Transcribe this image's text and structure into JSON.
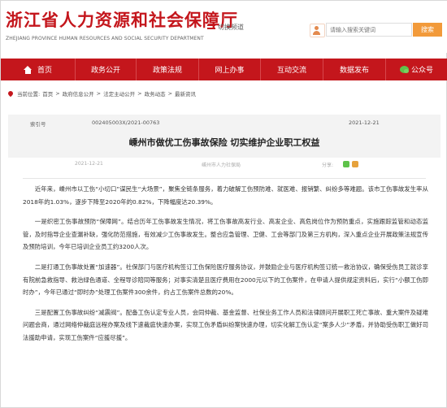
{
  "header": {
    "logo_cn": "浙江省人力资源和社会保障厅",
    "logo_en": "ZHEJIANG PROVINCE HUMAN RESOURCES AND SOCIAL SECURITY DEPARTMENT",
    "switch_label": "切换频道",
    "search_placeholder": "请输入搜索关键词",
    "search_button": "搜索"
  },
  "nav": {
    "items": [
      "首页",
      "政务公开",
      "政策法规",
      "网上办事",
      "互动交流",
      "数据发布"
    ],
    "wechat": "公众号"
  },
  "breadcrumb": {
    "prefix": "当前位置:",
    "items": [
      "首页",
      "政府信息公开",
      "法定主动公开",
      "政务动态",
      "最新资讯"
    ],
    "separator": ">"
  },
  "meta": {
    "index_label": "索引号",
    "index_value": "002405003X/2021-00763",
    "date": "2021-12-21"
  },
  "article": {
    "title": "嵊州市做优工伤事故保险 切实维护企业职工权益",
    "date": "2021-12-21",
    "source": "嵊州市人力社保局",
    "share_label": "分享:",
    "paragraphs": [
      "近年来，嵊州市以工伤“小切口”谋民生“大场景”，聚焦全链条服务，着力破解工伤预防难、就医难、报销繁、纠纷多等难题。该市工伤事故发生率从2018年的1.03%，逐步下降至2020年的0.82%，下降幅度达20.39%。",
      "一是织密工伤事故预防“保障网”。结合历年工伤事故发生情况，将工伤事故高发行业、高发企业、高危岗位作为预防重点，实施跟踪监管和动态监管，及时指导企业查漏补缺，强化防范措施，有效减少工伤事故发生。整合应急管理、卫健、工会等部门及第三方机构，深入重点企业开展政策法规宣传及预防培训，今年已培训企业员工约3200人次。",
      "二是打通工伤事故处置“加速器”。社保部门与医疗机构签订工伤保险医疗服务协议，并鼓励企业与医疗机构签订统一救治协议，确保受伤员工就诊享有院前急救指导、救治绿色通道、全程导诊陪同等服务；对事实清楚且医疗费用在2000元以下的工伤案件，在申请人提供规定资料后，实行“小额工伤即时办”，今年已通过“即时办”处理工伤案件300余件，约占工伤案件总数的20%。",
      "三是配置工伤事故纠纷“减震阀”。配备工伤认定专业人员，会同仲裁、基金监督、社保业务工作人员和法律顾问开展职工死亡事故、重大案件及疑难问题会商，通过网络仲裁庭远程办案及线下速裁庭快速办案，实现工伤矛盾纠纷案快速办理，切实化解工伤认定“案多人少”矛盾，并协助受伤职工做好司法援助申请，实现工伤案件“应援尽援”。"
    ]
  },
  "colors": {
    "brand_red": "#c4161c",
    "search_orange": "#f29a3a"
  }
}
